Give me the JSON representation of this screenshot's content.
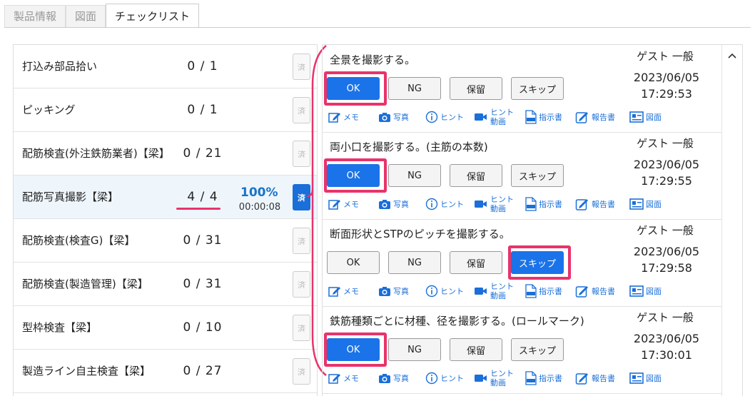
{
  "tabs": [
    "製品情報",
    "図面",
    "チェックリスト"
  ],
  "checklist": [
    {
      "name": "打込み部品拾い",
      "count": "0 / 1",
      "done": "済"
    },
    {
      "name": "ピッキング",
      "count": "0 / 1",
      "done": "済"
    },
    {
      "name": "配筋検査(外注鉄筋業者)【梁】",
      "count": "0 / 21",
      "done": "済"
    },
    {
      "name": "配筋写真撮影【梁】",
      "count": "4 / 4",
      "percent": "100%",
      "elapsed": "00:00:08",
      "done": "済"
    },
    {
      "name": "配筋検査(検査G)【梁】",
      "count": "0 / 31",
      "done": "済"
    },
    {
      "name": "配筋検査(製造管理)【梁】",
      "count": "0 / 31",
      "done": "済"
    },
    {
      "name": "型枠検査【梁】",
      "count": "0 / 10",
      "done": "済"
    },
    {
      "name": "製造ライン自主検査【梁】",
      "count": "0 / 27",
      "done": "済"
    }
  ],
  "buttons": {
    "ok": "OK",
    "ng": "NG",
    "hold": "保留",
    "skip": "スキップ"
  },
  "tools": {
    "memo": "メモ",
    "photo": "写真",
    "hint": "ヒント",
    "hint_video_1": "ヒント",
    "hint_video_2": "動画",
    "instruction": "指示書",
    "report": "報告書",
    "drawing": "図面"
  },
  "items": [
    {
      "question": "全景を撮影する。",
      "user": "ゲスト 一般",
      "date": "2023/06/05",
      "time": "17:29:53",
      "selected": "ok"
    },
    {
      "question": "両小口を撮影する。(主筋の本数)",
      "user": "ゲスト 一般",
      "date": "2023/06/05",
      "time": "17:29:55",
      "selected": "ok"
    },
    {
      "question": "断面形状とSTPのピッチを撮影する。",
      "user": "ゲスト 一般",
      "date": "2023/06/05",
      "time": "17:29:58",
      "selected": "skip"
    },
    {
      "question": "鉄筋種類ごとに材種、径を撮影する。(ロールマーク)",
      "user": "ゲスト 一般",
      "date": "2023/06/05",
      "time": "17:30:01",
      "selected": "ok"
    }
  ],
  "colors": {
    "accent": "#1a73e8",
    "highlight": "#e8336b",
    "selected_row": "#eef6fc"
  },
  "icons": [
    "memo-icon",
    "camera-icon",
    "info-icon",
    "video-icon",
    "pdf-icon",
    "report-icon",
    "drawing-icon",
    "chevron-up-icon"
  ]
}
